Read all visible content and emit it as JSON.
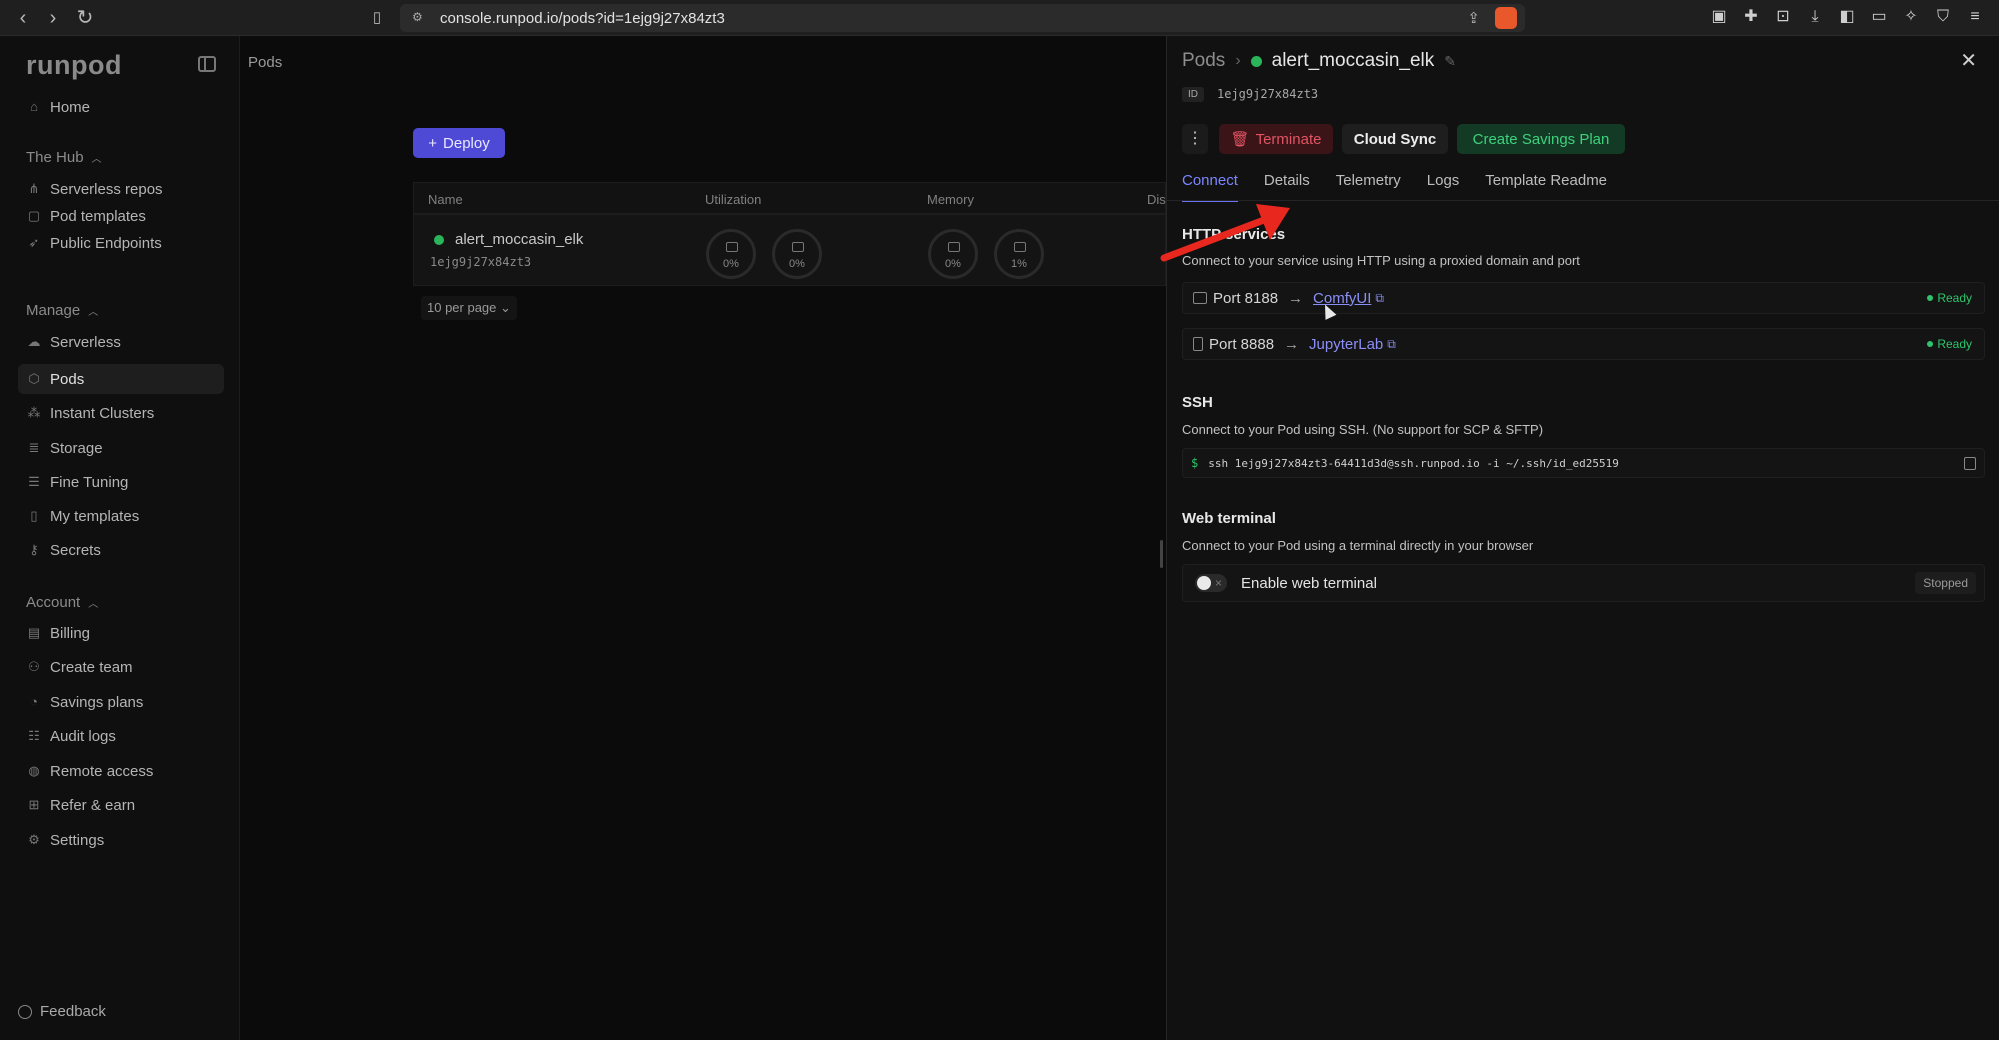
{
  "browser": {
    "url": "console.runpod.io/pods?id=1ejg9j27x84zt3"
  },
  "sidebar": {
    "logo": "runpod",
    "home": "Home",
    "hub": {
      "title": "The Hub",
      "items": [
        "Serverless repos",
        "Pod templates",
        "Public Endpoints"
      ]
    },
    "manage": {
      "title": "Manage",
      "items": [
        "Serverless",
        "Pods",
        "Instant Clusters",
        "Storage",
        "Fine Tuning",
        "My templates",
        "Secrets"
      ]
    },
    "account": {
      "title": "Account",
      "items": [
        "Billing",
        "Create team",
        "Savings plans",
        "Audit logs",
        "Remote access",
        "Refer & earn",
        "Settings"
      ]
    },
    "feedback": "Feedback"
  },
  "main": {
    "title": "Pods",
    "deploy_label": "Deploy",
    "columns": [
      "Name",
      "Utilization",
      "Memory",
      "Dis"
    ],
    "pod": {
      "name": "alert_moccasin_elk",
      "id": "1ejg9j27x84zt3",
      "util": [
        "0%",
        "0%"
      ],
      "memory": [
        "0%",
        "1%"
      ]
    },
    "per_page": "10 per page"
  },
  "panel": {
    "breadcrumb_root": "Pods",
    "pod_name": "alert_moccasin_elk",
    "id_label": "ID",
    "id_value": "1ejg9j27x84zt3",
    "buttons": {
      "terminate": "Terminate",
      "cloud_sync": "Cloud Sync",
      "savings": "Create Savings Plan"
    },
    "tabs": [
      "Connect",
      "Details",
      "Telemetry",
      "Logs",
      "Template Readme"
    ],
    "http": {
      "title": "HTTP services",
      "desc": "Connect to your service using HTTP using a proxied domain and port",
      "services": [
        {
          "port": "Port 8188",
          "name": "ComfyUI",
          "status": "Ready"
        },
        {
          "port": "Port 8888",
          "name": "JupyterLab",
          "status": "Ready"
        }
      ]
    },
    "ssh": {
      "title": "SSH",
      "desc": "Connect to your Pod using SSH. (No support for SCP & SFTP)",
      "prompt": "$",
      "command": "ssh 1ejg9j27x84zt3-64411d3d@ssh.runpod.io -i ~/.ssh/id_ed25519"
    },
    "web_terminal": {
      "title": "Web terminal",
      "desc": "Connect to your Pod using a terminal directly in your browser",
      "toggle_label": "Enable web terminal",
      "status": "Stopped"
    }
  },
  "colors": {
    "accent": "#6c74f5",
    "ready": "#2fc46b",
    "danger": "#e05463",
    "annotation": "#e8281e"
  }
}
